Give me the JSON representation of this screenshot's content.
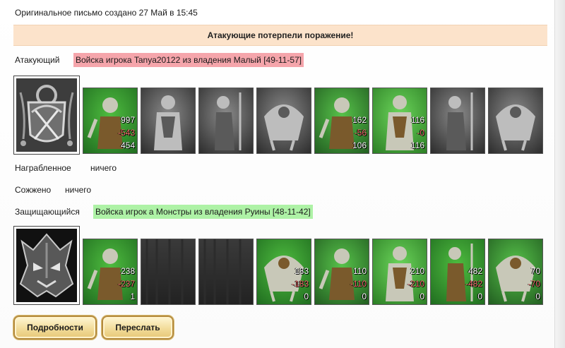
{
  "header": {
    "created_text": "Оригинальное письмо создано 27 Май в 15:45"
  },
  "banner": {
    "text": "Атакующие потерпели поражение!"
  },
  "attacker": {
    "label": "Атакующий",
    "troops_text": "Войска игрока Tanya20122 из владения Малый [49-11-57]",
    "units": [
      {
        "icon": "dwarf-warrior-unit",
        "total": "997",
        "lost": "-543",
        "left": "454",
        "colored": true
      },
      {
        "icon": "armored-knight-unit",
        "colored": false
      },
      {
        "icon": "spear-warrior-unit",
        "colored": false
      },
      {
        "icon": "griffin-unit",
        "colored": false
      },
      {
        "icon": "elf-archer-unit",
        "total": "162",
        "lost": "-56",
        "left": "106",
        "colored": true
      },
      {
        "icon": "druid-mage-unit",
        "total": "116",
        "lost": "-0",
        "left": "116",
        "colored": true
      },
      {
        "icon": "hooded-monk-unit",
        "colored": false
      },
      {
        "icon": "wizard-unit",
        "colored": false
      }
    ]
  },
  "loot": {
    "plundered_label": "Награбленное",
    "plundered_value": "ничего",
    "burned_label": "Сожжено",
    "burned_value": "ничего"
  },
  "defender": {
    "label": "Защищающийся",
    "troops_text": "Войска игрок а Монстры из владения Руины [48-11-42]",
    "units": [
      {
        "icon": "toad-beast-unit",
        "total": "238",
        "lost": "-237",
        "left": "1",
        "colored": true
      },
      {
        "icon": "empty-slot",
        "colored": false,
        "empty": true
      },
      {
        "icon": "empty-slot",
        "colored": false,
        "empty": true
      },
      {
        "icon": "green-gargoyle-unit",
        "total": "183",
        "lost": "-183",
        "left": "0",
        "colored": true
      },
      {
        "icon": "spider-beast-unit",
        "total": "110",
        "lost": "-110",
        "left": "0",
        "colored": true
      },
      {
        "icon": "swamp-witch-unit",
        "total": "210",
        "lost": "-210",
        "left": "0",
        "colored": true
      },
      {
        "icon": "green-ghost-unit",
        "total": "482",
        "lost": "-482",
        "left": "0",
        "colored": true
      },
      {
        "icon": "naga-serpent-unit",
        "total": "70",
        "lost": "-70",
        "left": "0",
        "colored": true
      }
    ]
  },
  "buttons": {
    "details": "Подробности",
    "forward": "Переслать"
  },
  "colors": {
    "banner_bg": "#fce3cb",
    "attacker_pill": "#f5a5ab",
    "defender_pill": "#aef2a6",
    "loss_red": "#f26d6d",
    "button_gold": "#e7c877"
  }
}
